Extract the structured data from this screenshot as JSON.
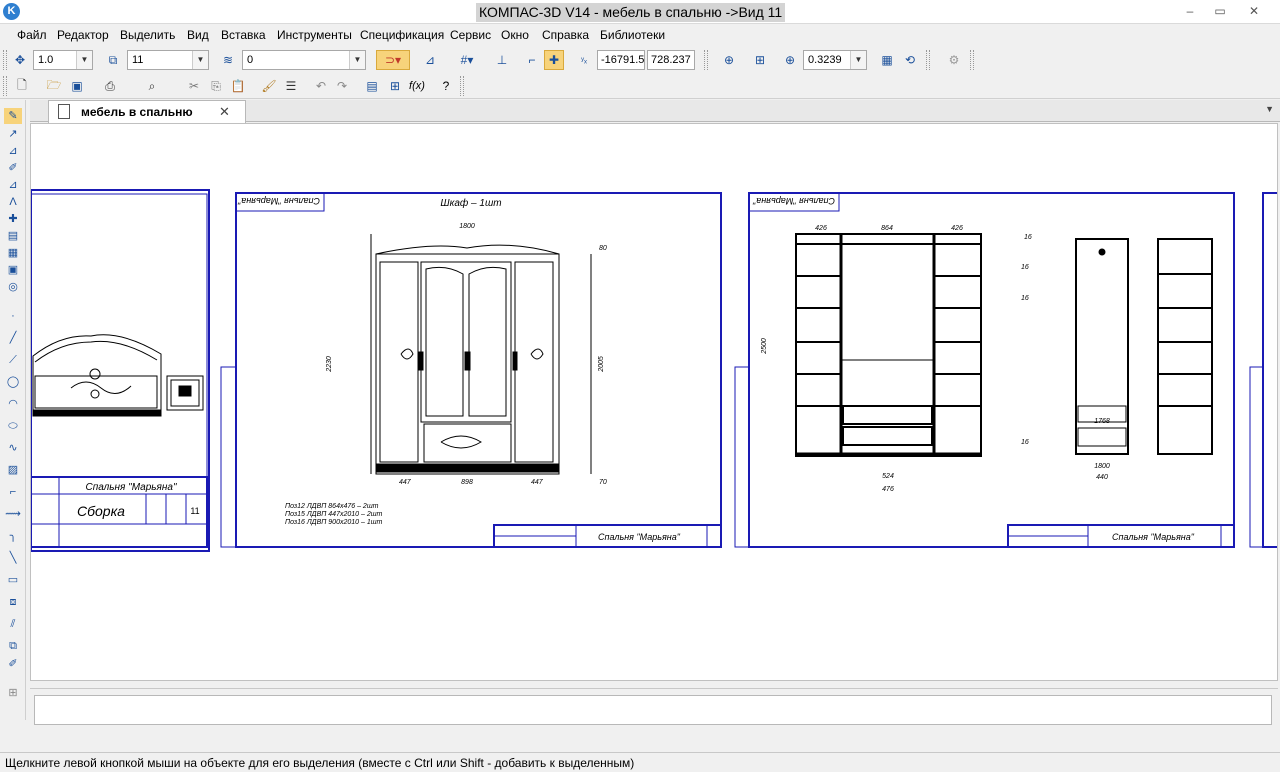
{
  "window": {
    "title": "КОМПАС-3D V14 - мебель в спальню ->Вид 11",
    "app_icon": "kompas-logo",
    "controls": {
      "minimize": "‒",
      "restore": "▭",
      "close": "✕"
    }
  },
  "menu": [
    "Файл",
    "Редактор",
    "Выделить",
    "Вид",
    "Вставка",
    "Инструменты",
    "Спецификация",
    "Сервис",
    "Окно",
    "Справка",
    "Библиотеки"
  ],
  "toolbar1": {
    "line_scale": "1.0",
    "view_number": "11",
    "layer": "0",
    "coord_x": "-16791.5",
    "coord_y": "728.237",
    "zoom": "0.3239",
    "icons": [
      "cursor-coords-icon",
      "views-icon",
      "layers-icon",
      "magnet-snap-icon",
      "snap-mode-icon",
      "grid-icon",
      "local-cs-icon",
      "ortho-icon",
      "round-icon",
      "zoom-window-icon",
      "zoom-frame-icon",
      "zoom-in-icon",
      "zoom-fit-icon",
      "redraw-icon",
      "properties-icon"
    ]
  },
  "toolbar2": {
    "icons": [
      "new-file-icon",
      "open-file-icon",
      "save-icon",
      "print-icon",
      "preview-icon",
      "cut-icon",
      "copy-icon",
      "paste-icon",
      "format-painter-icon",
      "manager-icon",
      "undo-icon",
      "redo-icon",
      "library-manager-icon",
      "variables-icon",
      "fx-icon",
      "help-icon"
    ],
    "fx_label": "f(x)"
  },
  "left_toolbar": [
    "geometry-icon",
    "dimensions-icon",
    "designations-icon",
    "editing-icon",
    "parametrization-icon",
    "measure-icon",
    "select-icon",
    "spec-icon",
    "reports-icon",
    "insert-icon",
    "views-icon",
    "point-icon",
    "line-icon",
    "segment-icon",
    "circle-icon",
    "arc-icon",
    "ellipse-icon",
    "spline-icon",
    "hatch-icon",
    "chamfer-icon",
    "polyline-icon",
    "fillet-icon",
    "rectangle-icon",
    "contour-icon",
    "equidistant-icon",
    "trim-icon",
    "fragment-icon"
  ],
  "tabs": [
    {
      "label": "мебель в спальню",
      "close": "✕"
    }
  ],
  "drawing": {
    "sheet_labels": [
      "Спальня \"Марьяна\"",
      "Спальня \"Марьяна\"",
      "Спальня \"Марьяна\""
    ],
    "assembly_title": "Сборка",
    "assembly_sheet_num": "11",
    "wardrobe_title": "Шкаф – 1шт",
    "notes": [
      "Поз12 ЛДВП 864х476 – 2шт",
      "Поз15 ЛДВП 447х2010 – 2шт",
      "Поз16 ЛДВП 900х2010 – 1шт"
    ],
    "dims_top": [
      "1800",
      "426",
      "864",
      "426",
      "16",
      "16",
      "16",
      "16"
    ],
    "dims_side": [
      "2230",
      "2500",
      "2005",
      "80",
      "70",
      "447",
      "447",
      "898",
      "447",
      "1768",
      "1800",
      "440",
      "524",
      "476"
    ],
    "rotated_label": "Спальня \"Марьяна\""
  },
  "status": "Щелкните левой кнопкой мыши на объекте для его выделения (вместе с Ctrl или Shift - добавить к выделенным)"
}
